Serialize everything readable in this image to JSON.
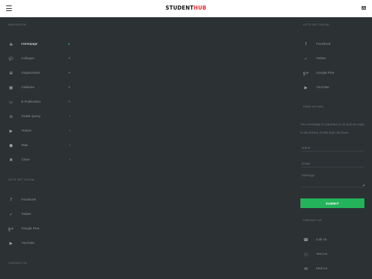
{
  "header": {
    "logo_main": "STUDENT",
    "logo_accent": "HUB",
    "menu_icon": "hamburger-menu-icon",
    "mail_icon": "envelope-icon"
  },
  "left": {
    "navigation_title": "NAVIGATION",
    "nav_items": [
      {
        "label": "Homepage",
        "icon": "home-icon",
        "right": ""
      },
      {
        "label": "Colleges",
        "icon": "graduation-cap-icon",
        "right": "+"
      },
      {
        "label": "Organization",
        "icon": "sitemap-icon",
        "right": "+"
      },
      {
        "label": "Galleries",
        "icon": "image-gallery-icon",
        "right": "+"
      },
      {
        "label": "E-Publication",
        "icon": "tablet-icon",
        "right": "+"
      },
      {
        "label": "Grade Query",
        "icon": "hdd-icon",
        "right": "›"
      },
      {
        "label": "Videos",
        "icon": "video-play-icon",
        "right": "›"
      },
      {
        "label": "Map",
        "icon": "map-marker-icon",
        "right": "›"
      },
      {
        "label": "Close",
        "icon": "close-x-icon",
        "right": "›"
      }
    ],
    "social_title": "LET'S GET SOCIAL",
    "social_items": [
      {
        "label": "Facebook",
        "icon": "facebook-icon"
      },
      {
        "label": "Twitter",
        "icon": "twitter-icon"
      },
      {
        "label": "Google Plus",
        "icon": "google-plus-icon"
      },
      {
        "label": "YouTube",
        "icon": "youtube-icon"
      }
    ],
    "contact_title": "CONTACT US"
  },
  "right": {
    "social_title": "LET'S GET SOCIAL",
    "social_items": [
      {
        "label": "Facebook",
        "icon": "facebook-icon"
      },
      {
        "label": "Twitter",
        "icon": "twitter-icon"
      },
      {
        "label": "Google Plus",
        "icon": "google-plus-icon"
      },
      {
        "label": "YouTube",
        "icon": "youtube-icon"
      }
    ],
    "send_title": "SEND US MAIL",
    "message_text": "Your message is important to us and we reply to all of them in less than 48 hours",
    "name_placeholder": "Name",
    "email_placeholder": "Email",
    "message_placeholder": "Message",
    "submit_label": "SUBMIT",
    "contact_title": "CONTACT US",
    "contact_items": [
      {
        "label": "Call Us",
        "icon": "phone-icon"
      },
      {
        "label": "Text Us",
        "icon": "chat-bubble-icon"
      },
      {
        "label": "Mail Us",
        "icon": "envelope-icon"
      }
    ]
  },
  "colors": {
    "background": "#2c3134",
    "accent_green": "#24b35b",
    "logo_red": "#e0332f"
  }
}
